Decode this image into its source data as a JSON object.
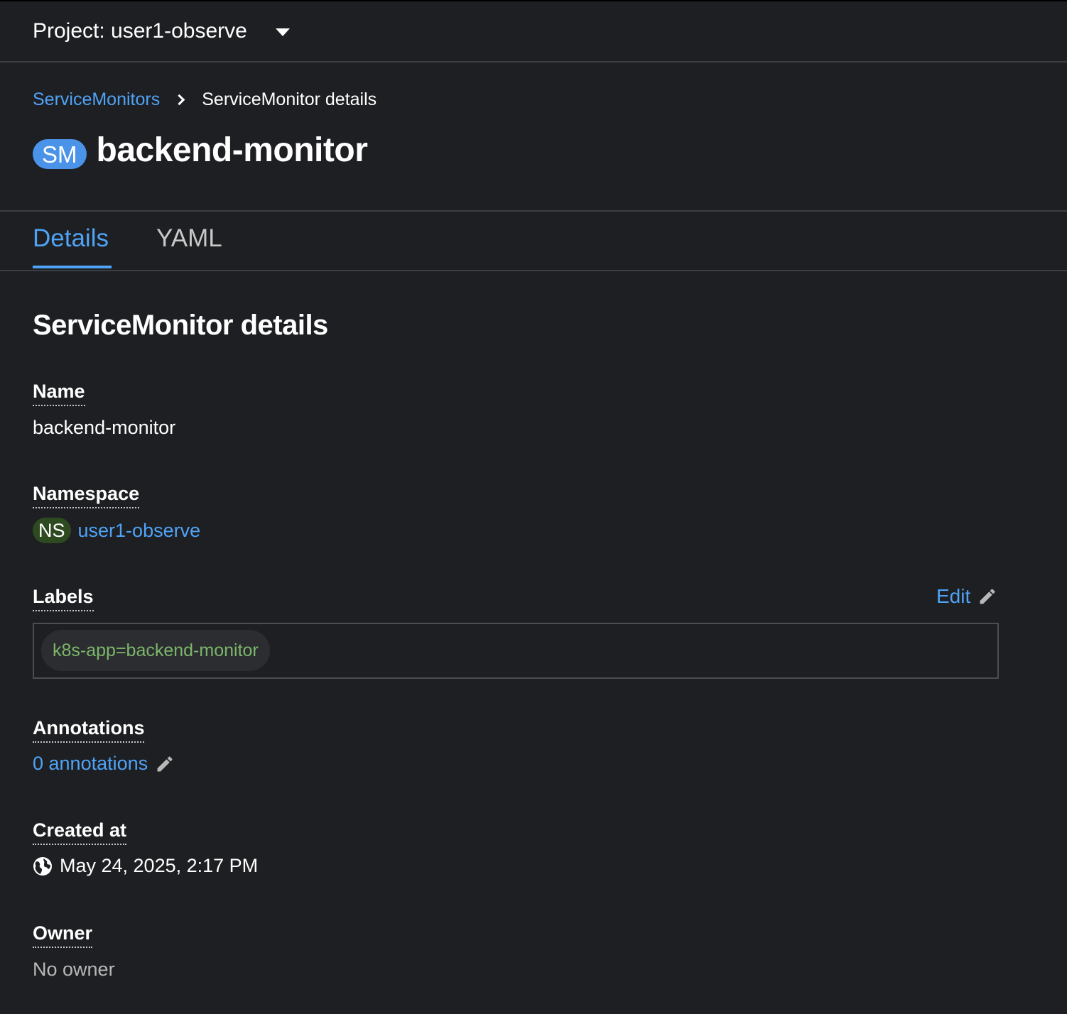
{
  "topbar": {
    "project_label": "Project: user1-observe"
  },
  "breadcrumb": {
    "parent": "ServiceMonitors",
    "current": "ServiceMonitor details"
  },
  "header": {
    "badge": "SM",
    "title": "backend-monitor"
  },
  "tabs": [
    {
      "label": "Details",
      "active": true
    },
    {
      "label": "YAML",
      "active": false
    }
  ],
  "details": {
    "section_title": "ServiceMonitor details",
    "name": {
      "label": "Name",
      "value": "backend-monitor"
    },
    "namespace": {
      "label": "Namespace",
      "badge": "NS",
      "value": "user1-observe"
    },
    "labels": {
      "label": "Labels",
      "edit": "Edit",
      "items": [
        "k8s-app=backend-monitor"
      ]
    },
    "annotations": {
      "label": "Annotations",
      "value": "0 annotations"
    },
    "created_at": {
      "label": "Created at",
      "value": "May 24, 2025, 2:17 PM"
    },
    "owner": {
      "label": "Owner",
      "value": "No owner"
    }
  },
  "colors": {
    "background": "#1e1f22",
    "link": "#4fa3f7",
    "sm_badge": "#4b93e8",
    "ns_badge": "#2e4a21",
    "label_text": "#7cb66a"
  },
  "icons": [
    "caret-down-icon",
    "chevron-right-icon",
    "pencil-icon",
    "globe-icon"
  ]
}
